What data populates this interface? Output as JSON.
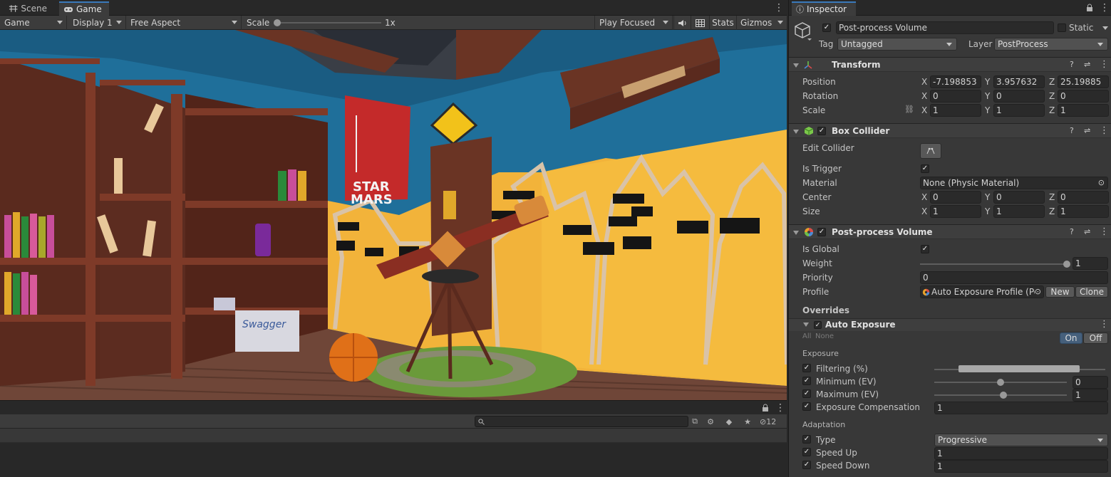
{
  "game_window": {
    "tabs": [
      {
        "label": "Scene",
        "icon": "scene-grid-icon"
      },
      {
        "label": "Game",
        "icon": "gamepad-icon"
      }
    ],
    "toolbar": {
      "mode": "Game",
      "display": "Display 1",
      "aspect": "Free Aspect",
      "scale_label": "Scale",
      "scale_value": "1x",
      "play_mode": "Play Focused",
      "stats": "Stats",
      "gizmos": "Gizmos"
    },
    "scene_text": {
      "banner_line1": "STAR",
      "banner_line2": "MARS",
      "box_label": "Swagger"
    },
    "hierarchy_hidden_count": "12"
  },
  "inspector": {
    "tab_label": "Inspector",
    "object": {
      "enabled": true,
      "name": "Post-process Volume",
      "static_label": "Static",
      "tag_label": "Tag",
      "tag": "Untagged",
      "layer_label": "Layer",
      "layer": "PostProcess"
    },
    "transform": {
      "title": "Transform",
      "position_label": "Position",
      "position": {
        "x": "-7.198853",
        "y": "3.957632",
        "z": "25.19885"
      },
      "rotation_label": "Rotation",
      "rotation": {
        "x": "0",
        "y": "0",
        "z": "0"
      },
      "scale_label": "Scale",
      "scale": {
        "x": "1",
        "y": "1",
        "z": "1"
      }
    },
    "box_collider": {
      "title": "Box Collider",
      "enabled": true,
      "edit_label": "Edit Collider",
      "is_trigger_label": "Is Trigger",
      "is_trigger": true,
      "material_label": "Material",
      "material": "None (Physic Material)",
      "center_label": "Center",
      "center": {
        "x": "0",
        "y": "0",
        "z": "0"
      },
      "size_label": "Size",
      "size": {
        "x": "1",
        "y": "1",
        "z": "1"
      }
    },
    "volume": {
      "title": "Post-process Volume",
      "enabled": true,
      "is_global_label": "Is Global",
      "is_global": true,
      "weight_label": "Weight",
      "weight": "1",
      "weight_fraction": 1.0,
      "priority_label": "Priority",
      "priority": "0",
      "profile_label": "Profile",
      "profile": "Auto Exposure Profile (Po",
      "new_label": "New",
      "clone_label": "Clone",
      "overrides_label": "Overrides"
    },
    "auto_exposure": {
      "title": "Auto Exposure",
      "enabled": true,
      "all_label": "All",
      "none_label": "None",
      "on_label": "On",
      "off_label": "Off",
      "exposure_section": "Exposure",
      "filtering_label": "Filtering (%)",
      "filtering_range": [
        0.14,
        0.85
      ],
      "minimum_label": "Minimum (EV)",
      "minimum": "0",
      "minimum_fraction": 0.5,
      "maximum_label": "Maximum (EV)",
      "maximum": "1",
      "maximum_fraction": 0.52,
      "exposure_comp_label": "Exposure Compensation",
      "exposure_comp": "1",
      "adaptation_section": "Adaptation",
      "type_label": "Type",
      "type": "Progressive",
      "speed_up_label": "Speed Up",
      "speed_up": "1",
      "speed_down_label": "Speed Down",
      "speed_down": "1"
    }
  },
  "colors": {
    "accent": "#3a79bb",
    "on_button": "#46607c",
    "wall_yellow": "#f2b33a",
    "wall_blue": "#1f6f9a"
  }
}
